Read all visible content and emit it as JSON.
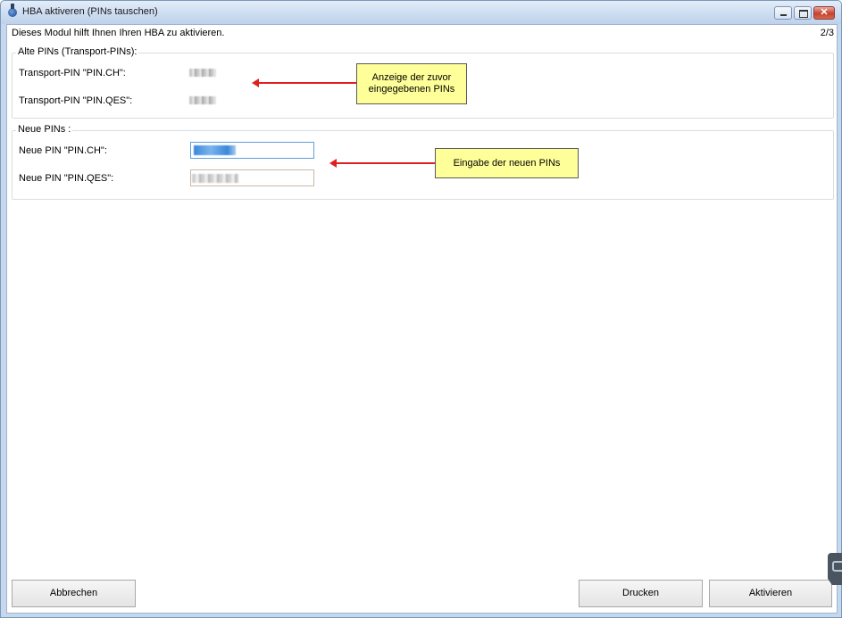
{
  "window": {
    "title": "HBA aktiveren (PINs tauschen)"
  },
  "header": {
    "info_text": "Dieses Modul hilft Ihnen Ihren HBA zu aktivieren.",
    "step": "2/3"
  },
  "alte_pins": {
    "legend": "Alte PINs  (Transport-PINs):",
    "rows": [
      {
        "label": "Transport-PIN \"PIN.CH\":"
      },
      {
        "label": "Transport-PIN \"PIN.QES\":"
      }
    ]
  },
  "neue_pins": {
    "legend": "Neue PINs :",
    "rows": [
      {
        "label": "Neue PIN \"PIN.CH\":"
      },
      {
        "label": "Neue PIN \"PIN.QES\":"
      }
    ]
  },
  "callouts": {
    "anzeige": "Anzeige der zuvor eingegebenen PINs",
    "eingabe": "Eingabe der neuen PINs"
  },
  "buttons": {
    "cancel": "Abbrechen",
    "print": "Drucken",
    "activate": "Aktivieren"
  },
  "colors": {
    "callout_bg": "#ffff99",
    "arrow": "#e02020",
    "focus_border": "#5fa0d8"
  },
  "icons": {
    "title": "hba-app-icon",
    "minimize": "minimize-icon",
    "maximize": "maximize-icon",
    "close": "close-icon",
    "side_tab": "side-panel-tab-icon"
  }
}
